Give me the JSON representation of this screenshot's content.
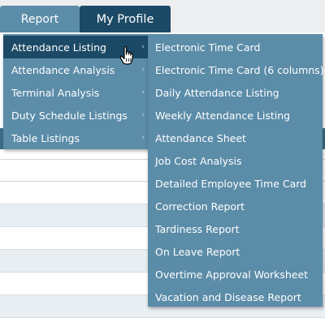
{
  "nav": {
    "tabs": [
      {
        "label": "Report"
      },
      {
        "label": "My Profile"
      }
    ]
  },
  "report_menu": {
    "items": [
      {
        "label": "Attendance Listing"
      },
      {
        "label": "Attendance Analysis"
      },
      {
        "label": "Terminal Analysis"
      },
      {
        "label": "Duty Schedule Listings"
      },
      {
        "label": "Table Listings"
      }
    ],
    "chevron": "›"
  },
  "attendance_listing_submenu": {
    "items": [
      {
        "label": "Electronic Time Card"
      },
      {
        "label": "Electronic Time Card (6 columns)"
      },
      {
        "label": "Daily Attendance Listing"
      },
      {
        "label": "Weekly Attendance Listing"
      },
      {
        "label": "Attendance Sheet"
      },
      {
        "label": "Job Cost Analysis"
      },
      {
        "label": "Detailed Employee Time Card"
      },
      {
        "label": "Correction Report"
      },
      {
        "label": "Tardiness Report"
      },
      {
        "label": "On Leave Report"
      },
      {
        "label": "Overtime Approval Worksheet"
      },
      {
        "label": "Vacation and Disease Report"
      }
    ]
  },
  "colors": {
    "menu_bg": "#5b8ca8",
    "menu_active": "#1c4a66",
    "header_band": "#3d6e88",
    "topbar_bg": "#eceeef"
  }
}
